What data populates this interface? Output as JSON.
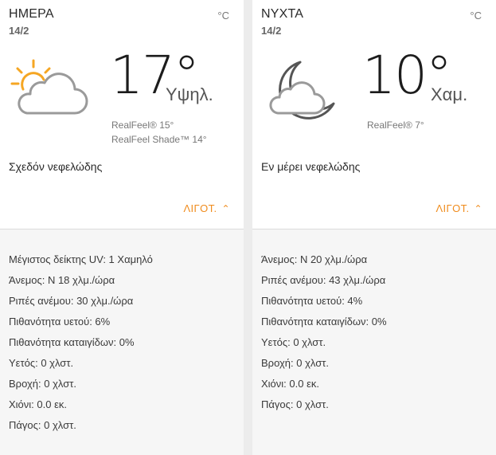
{
  "colors": {
    "accent": "#f08c1d",
    "sun": "#f5a623",
    "cloud_stroke": "#9a9a9a"
  },
  "day": {
    "title": "ΗΜΕΡΑ",
    "date": "14/2",
    "unit": "°C",
    "icon": "partly-sunny-icon",
    "temp": "17°",
    "hl": "Υψηλ.",
    "realfeel": "RealFeel® 15°",
    "realfeel_shade": "RealFeel Shade™ 14°",
    "phrase": "Σχεδόν νεφελώδης",
    "less": "ΛΙΓΟΤ.",
    "details": [
      "Μέγιστος δείκτης UV: 1 Χαμηλό",
      "Άνεμος: Ν 18 χλμ./ώρα",
      "Ριπές ανέμου: 30 χλμ./ώρα",
      "Πιθανότητα υετού: 6%",
      "Πιθανότητα καταιγίδων: 0%",
      "Υετός: 0 χλστ.",
      "Βροχή: 0 χλστ.",
      "Χιόνι: 0.0 εκ.",
      "Πάγος: 0 χλστ."
    ]
  },
  "night": {
    "title": "ΝΥΧΤΑ",
    "date": "14/2",
    "unit": "°C",
    "icon": "partly-cloudy-night-icon",
    "temp": "10°",
    "hl": "Χαμ.",
    "realfeel": "RealFeel® 7°",
    "phrase": "Εν μέρει νεφελώδης",
    "less": "ΛΙΓΟΤ.",
    "details": [
      "Άνεμος: Ν 20 χλμ./ώρα",
      "Ριπές ανέμου: 43 χλμ./ώρα",
      "Πιθανότητα υετού: 4%",
      "Πιθανότητα καταιγίδων: 0%",
      "Υετός: 0 χλστ.",
      "Βροχή: 0 χλστ.",
      "Χιόνι: 0.0 εκ.",
      "Πάγος: 0 χλστ."
    ]
  }
}
